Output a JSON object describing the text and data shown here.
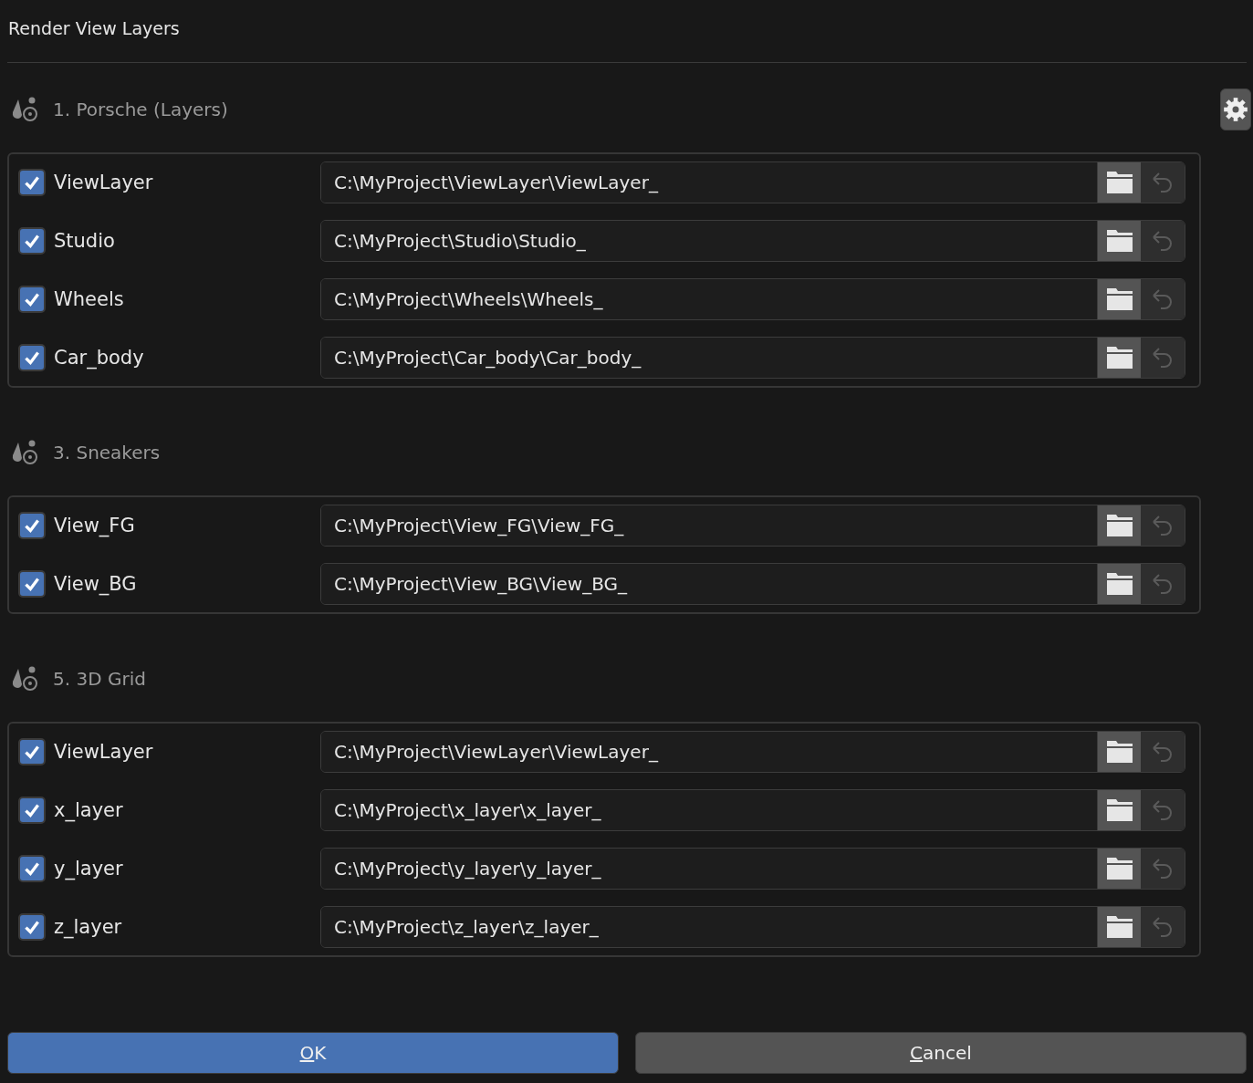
{
  "window": {
    "title": "Render View Layers"
  },
  "sections": [
    {
      "title": "1. Porsche (Layers)",
      "settings_button": true,
      "layers": [
        {
          "name": "ViewLayer",
          "checked": true,
          "path": "C:\\MyProject\\ViewLayer\\ViewLayer_"
        },
        {
          "name": "Studio",
          "checked": true,
          "path": "C:\\MyProject\\Studio\\Studio_"
        },
        {
          "name": "Wheels",
          "checked": true,
          "path": "C:\\MyProject\\Wheels\\Wheels_"
        },
        {
          "name": "Car_body",
          "checked": true,
          "path": "C:\\MyProject\\Car_body\\Car_body_"
        }
      ]
    },
    {
      "title": "3. Sneakers",
      "settings_button": false,
      "layers": [
        {
          "name": "View_FG",
          "checked": true,
          "path": "C:\\MyProject\\View_FG\\View_FG_"
        },
        {
          "name": "View_BG",
          "checked": true,
          "path": "C:\\MyProject\\View_BG\\View_BG_"
        }
      ]
    },
    {
      "title": "5. 3D Grid",
      "settings_button": false,
      "layers": [
        {
          "name": "ViewLayer",
          "checked": true,
          "path": "C:\\MyProject\\ViewLayer\\ViewLayer_"
        },
        {
          "name": "x_layer",
          "checked": true,
          "path": "C:\\MyProject\\x_layer\\x_layer_"
        },
        {
          "name": "y_layer",
          "checked": true,
          "path": "C:\\MyProject\\y_layer\\y_layer_"
        },
        {
          "name": "z_layer",
          "checked": true,
          "path": "C:\\MyProject\\z_layer\\z_layer_"
        }
      ]
    }
  ],
  "buttons": [
    {
      "label": "OK",
      "kind": "primary"
    },
    {
      "label": "Cancel",
      "kind": "secondary"
    }
  ]
}
